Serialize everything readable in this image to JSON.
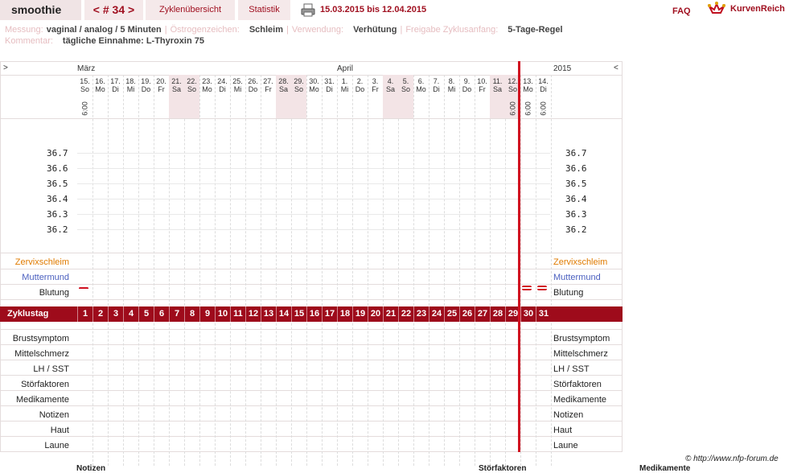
{
  "app_title": "smoothie",
  "cycle_nav": "< # 34 >",
  "tabs": [
    "Zyklenübersicht",
    "Statistik"
  ],
  "date_range": "15.03.2015 bis 12.04.2015",
  "faq": "FAQ",
  "brand": "KurvenReich",
  "meta": {
    "messung_k": "Messung:",
    "messung_v": "vaginal / analog / 5 Minuten",
    "oestrogen_k": "Östrogenzeichen:",
    "oestrogen_v": "Schleim",
    "verwendung_k": "Verwendung:",
    "verwendung_v": "Verhütung",
    "freigabe_k": "Freigabe Zyklusanfang:",
    "freigabe_v": "5-Tage-Regel",
    "kommentar_k": "Kommentar:",
    "kommentar_v": "tägliche Einnahme: L-Thyroxin 75"
  },
  "nav_left": ">",
  "nav_right": "<",
  "month_maerz": "März",
  "month_april": "April",
  "year": "2015",
  "days": [
    {
      "d": "15.",
      "w": "So",
      "t": "6:00"
    },
    {
      "d": "16.",
      "w": "Mo"
    },
    {
      "d": "17.",
      "w": "Di"
    },
    {
      "d": "18.",
      "w": "Mi"
    },
    {
      "d": "19.",
      "w": "Do"
    },
    {
      "d": "20.",
      "w": "Fr"
    },
    {
      "d": "21.",
      "w": "Sa"
    },
    {
      "d": "22.",
      "w": "So"
    },
    {
      "d": "23.",
      "w": "Mo"
    },
    {
      "d": "24.",
      "w": "Di"
    },
    {
      "d": "25.",
      "w": "Mi"
    },
    {
      "d": "26.",
      "w": "Do"
    },
    {
      "d": "27.",
      "w": "Fr"
    },
    {
      "d": "28.",
      "w": "Sa"
    },
    {
      "d": "29.",
      "w": "So"
    },
    {
      "d": "30.",
      "w": "Mo"
    },
    {
      "d": "31.",
      "w": "Di"
    },
    {
      "d": "1.",
      "w": "Mi"
    },
    {
      "d": "2.",
      "w": "Do"
    },
    {
      "d": "3.",
      "w": "Fr"
    },
    {
      "d": "4.",
      "w": "Sa"
    },
    {
      "d": "5.",
      "w": "So"
    },
    {
      "d": "6.",
      "w": "Mo"
    },
    {
      "d": "7.",
      "w": "Di"
    },
    {
      "d": "8.",
      "w": "Mi"
    },
    {
      "d": "9.",
      "w": "Do"
    },
    {
      "d": "10.",
      "w": "Fr"
    },
    {
      "d": "11.",
      "w": "Sa"
    },
    {
      "d": "12.",
      "w": "So",
      "t": "6:00"
    },
    {
      "d": "13.",
      "w": "Mo",
      "t": "6:00"
    },
    {
      "d": "14.",
      "w": "Di",
      "t": "6:00"
    }
  ],
  "temps": [
    "36.7",
    "36.6",
    "36.5",
    "36.4",
    "36.3",
    "36.2"
  ],
  "row_labels": {
    "zervix": "Zervixschleim",
    "muttermund": "Muttermund",
    "blutung": "Blutung",
    "zyklustag": "Zyklustag"
  },
  "bottom_rows": [
    "Brustsymptom",
    "Mittelschmerz",
    "LH / SST",
    "Störfaktoren",
    "Medikamente",
    "Notizen",
    "Haut",
    "Laune"
  ],
  "bleeding_days": [
    1,
    30,
    31
  ],
  "colors": {
    "brand": "#a01020",
    "zervix": "#e07b00",
    "muttermund": "#4a5fbf",
    "weekend": "#f3e4e6"
  },
  "footer": {
    "notizen": "Notizen",
    "stoerfaktoren": "Störfaktoren",
    "medikamente": "Medikamente",
    "copyright": "© http://www.nfp-forum.de"
  }
}
